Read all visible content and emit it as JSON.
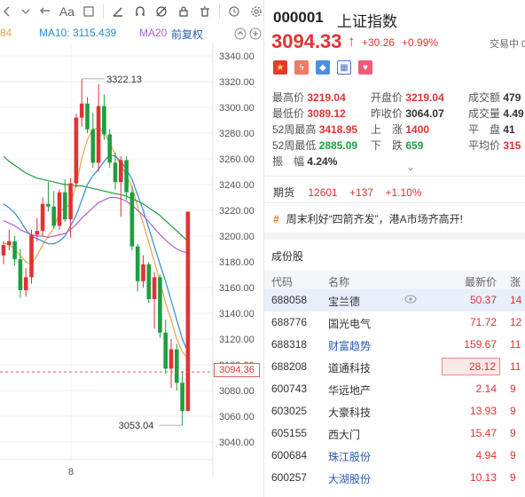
{
  "toolbar": {
    "icons": [
      "left-arrow-icon",
      "dropdown-arrow-icon",
      "undo-icon",
      "text-style-icon",
      "checkbox-icon",
      "pencil-icon",
      "magnet-icon",
      "hide-icon",
      "lock-icon",
      "trash-icon",
      "clock-icon",
      "settings-icon"
    ],
    "text_style_label": "Aa"
  },
  "ma": {
    "prev_value": "84",
    "ma10_label": "MA10:",
    "ma10_value": "3115.439",
    "ma20_label": "MA20",
    "adjust_label": "前复权",
    "colors": {
      "prev": "#e9a24d",
      "ma10": "#2e8bcc",
      "ma20": "#b25fd6",
      "adjust": "#2a5db0"
    }
  },
  "chart": {
    "y_ticks": [
      "3340.00",
      "3320.00",
      "3300.00",
      "3280.00",
      "3260.00",
      "3240.00",
      "3220.00",
      "3200.00",
      "3180.00",
      "3160.00",
      "3140.00",
      "3120.00",
      "3100.00",
      "3080.00",
      "3060.00",
      "3040.00"
    ],
    "high_label": "3322.13",
    "low_label": "3053.04",
    "current_price": "3094.36",
    "x_label": "8"
  },
  "quote": {
    "code": "000001",
    "name": "上证指数",
    "price": "3094.33",
    "change": "+30.26",
    "change_pct": "+0.99%",
    "status": "交易中 0"
  },
  "stats": {
    "high_label": "最高价",
    "high": "3219.04",
    "open_label": "开盘价",
    "open": "3219.04",
    "amount_label": "成交额",
    "amount": "479",
    "low_label": "最低价",
    "low": "3089.12",
    "prev_close_label": "昨收价",
    "prev_close": "3064.07",
    "volume_label": "成交量",
    "volume": "4.49",
    "wk52_high_label": "52周最高",
    "wk52_high": "3418.95",
    "up_label": "上　涨",
    "up": "1400",
    "flat_label": "平　盘",
    "flat": "41",
    "wk52_low_label": "52周最低",
    "wk52_low": "2885.09",
    "down_label": "下　跌",
    "down": "659",
    "avg_label": "平均价",
    "avg": "315",
    "amplitude_label": "振　幅",
    "amplitude": "4.24%"
  },
  "futures": {
    "label": "期货",
    "price": "12601",
    "change": "+137",
    "pct": "+1.10%"
  },
  "news": {
    "text": "周末利好“四箭齐发”，港A市场齐高开!"
  },
  "constituents": {
    "title": "成份股",
    "headers": {
      "code": "代码",
      "name": "名称",
      "price": "最新价",
      "chg": "涨"
    },
    "rows": [
      {
        "code": "688058",
        "name": "宝兰德",
        "price": "50.37",
        "chg": "14"
      },
      {
        "code": "688776",
        "name": "国光电气",
        "price": "71.72",
        "chg": "12"
      },
      {
        "code": "688318",
        "name": "财富趋势",
        "price": "159.67",
        "chg": "11"
      },
      {
        "code": "688208",
        "name": "道通科技",
        "price": "28.12",
        "chg": "11"
      },
      {
        "code": "600743",
        "name": "华远地产",
        "price": "2.14",
        "chg": "9"
      },
      {
        "code": "603025",
        "name": "大豪科技",
        "price": "13.93",
        "chg": "9"
      },
      {
        "code": "605155",
        "name": "西大门",
        "price": "15.47",
        "chg": "9"
      },
      {
        "code": "600684",
        "name": "珠江股份",
        "price": "4.94",
        "chg": "9"
      },
      {
        "code": "600257",
        "name": "大湖股份",
        "price": "10.13",
        "chg": "9"
      }
    ]
  },
  "chart_data": {
    "type": "candlestick",
    "ylim": [
      3040,
      3340
    ],
    "current": 3094.36,
    "candles": [
      [
        3185,
        3196,
        3178,
        3193
      ],
      [
        3193,
        3205,
        3189,
        3196
      ],
      [
        3196,
        3200,
        3177,
        3182
      ],
      [
        3182,
        3190,
        3152,
        3158
      ],
      [
        3158,
        3175,
        3153,
        3168
      ],
      [
        3168,
        3205,
        3163,
        3201
      ],
      [
        3201,
        3214,
        3196,
        3204
      ],
      [
        3204,
        3230,
        3200,
        3225
      ],
      [
        3225,
        3242,
        3219,
        3223
      ],
      [
        3223,
        3235,
        3206,
        3208
      ],
      [
        3208,
        3236,
        3205,
        3234
      ],
      [
        3234,
        3244,
        3211,
        3213
      ],
      [
        3213,
        3245,
        3199,
        3241
      ],
      [
        3241,
        3295,
        3238,
        3292
      ],
      [
        3292,
        3322,
        3285,
        3303
      ],
      [
        3303,
        3308,
        3280,
        3283
      ],
      [
        3283,
        3296,
        3253,
        3257
      ],
      [
        3257,
        3318,
        3250,
        3301
      ],
      [
        3301,
        3310,
        3275,
        3279
      ],
      [
        3279,
        3283,
        3253,
        3257
      ],
      [
        3257,
        3265,
        3236,
        3242
      ],
      [
        3242,
        3262,
        3215,
        3259
      ],
      [
        3259,
        3262,
        3228,
        3234
      ],
      [
        3234,
        3239,
        3189,
        3192
      ],
      [
        3192,
        3194,
        3157,
        3165
      ],
      [
        3165,
        3185,
        3160,
        3178
      ],
      [
        3178,
        3180,
        3148,
        3151
      ],
      [
        3151,
        3172,
        3128,
        3168
      ],
      [
        3168,
        3170,
        3121,
        3125
      ],
      [
        3125,
        3135,
        3093,
        3097
      ],
      [
        3097,
        3120,
        3082,
        3112
      ],
      [
        3112,
        3116,
        3080,
        3086
      ],
      [
        3086,
        3095,
        3053,
        3064
      ],
      [
        3064,
        3219,
        3089,
        3219
      ]
    ],
    "lines": [
      {
        "name": "ma5",
        "color": "#e9a24d",
        "values": [
          3195,
          3193,
          3190,
          3185,
          3180,
          3178,
          3185,
          3193,
          3200,
          3206,
          3219,
          3222,
          3225,
          3240,
          3260,
          3275,
          3283,
          3284,
          3280,
          3273,
          3263,
          3255,
          3247,
          3238,
          3223,
          3210,
          3195,
          3180,
          3165,
          3148,
          3135,
          3120,
          3110,
          3105
        ]
      },
      {
        "name": "ma10",
        "color": "#2e8bcc",
        "values": [
          3225,
          3222,
          3218,
          3212,
          3205,
          3200,
          3198,
          3196,
          3194,
          3194,
          3196,
          3200,
          3208,
          3216,
          3228,
          3240,
          3247,
          3252,
          3258,
          3263,
          3262,
          3258,
          3252,
          3244,
          3232,
          3220,
          3206,
          3192,
          3178,
          3165,
          3150,
          3135,
          3120,
          3110
        ]
      },
      {
        "name": "ma20",
        "color": "#b25fd6",
        "values": [
          3212,
          3210,
          3208,
          3205,
          3203,
          3201,
          3200,
          3200,
          3199,
          3200,
          3201,
          3202,
          3205,
          3209,
          3214,
          3218,
          3222,
          3226,
          3228,
          3230,
          3230,
          3229,
          3227,
          3224,
          3220,
          3216,
          3211,
          3206,
          3201,
          3197,
          3193,
          3190,
          3188,
          3187
        ]
      },
      {
        "name": "ma60",
        "color": "#1f9e3f",
        "values": [
          3262,
          3258,
          3255,
          3252,
          3249,
          3247,
          3245,
          3244,
          3243,
          3242,
          3241,
          3240,
          3240,
          3239,
          3239,
          3238,
          3237,
          3236,
          3235,
          3234,
          3233,
          3232,
          3231,
          3229,
          3227,
          3225,
          3222,
          3219,
          3216,
          3212,
          3208,
          3204,
          3200,
          3196
        ]
      }
    ]
  }
}
